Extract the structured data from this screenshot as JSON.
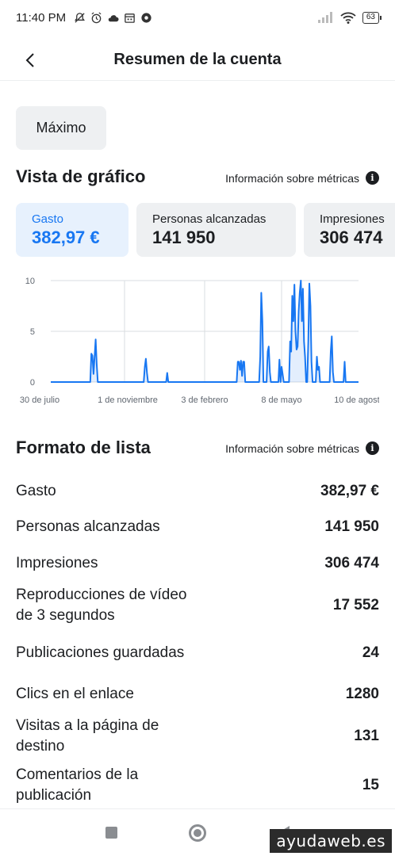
{
  "status_bar": {
    "time": "11:40 PM",
    "battery": "63",
    "icons_left": [
      "mute-icon",
      "alarm-icon",
      "cloud-icon",
      "calendar-icon",
      "settings-icon"
    ],
    "icons_right": [
      "signal-icon",
      "wifi-icon",
      "battery-icon"
    ]
  },
  "header": {
    "title": "Resumen de la cuenta",
    "back_icon": "chevron-left-icon"
  },
  "filter": {
    "label": "Máximo"
  },
  "chart_section": {
    "title": "Vista de gráfico",
    "info_link": "Información sobre métricas",
    "info_icon": "info-icon"
  },
  "metric_cards": [
    {
      "label": "Gasto",
      "value": "382,97 €",
      "active": true
    },
    {
      "label": "Personas alcanzadas",
      "value": "141 950",
      "active": false
    },
    {
      "label": "Impresiones",
      "value": "306 474",
      "active": false
    }
  ],
  "chart_data": {
    "type": "area",
    "title": "",
    "xlabel": "",
    "ylabel": "",
    "ylim": [
      0,
      10
    ],
    "yticks": [
      "10",
      "5",
      "0"
    ],
    "xticks": [
      "30 de julio",
      "1 de noviembre",
      "3 de febrero",
      "8 de mayo",
      "10 de agosto"
    ],
    "grid": true,
    "color": "#1877f2",
    "series": [
      {
        "values": [
          0,
          0,
          0,
          0,
          0,
          0,
          0,
          0,
          0,
          0,
          0,
          0,
          0,
          0,
          0,
          0,
          0,
          0,
          0,
          0,
          0,
          0,
          0,
          0,
          0,
          0,
          0,
          0,
          0,
          0,
          0,
          0,
          0,
          0,
          0,
          0,
          0,
          0,
          2.8,
          2.6,
          0.8,
          2.4,
          4.2,
          1.8,
          0,
          0,
          0,
          0,
          0,
          0,
          0,
          0,
          0,
          0,
          0,
          0,
          0,
          0,
          0,
          0,
          0,
          0,
          0,
          0,
          0,
          0,
          0,
          0,
          0,
          0,
          0,
          0,
          0,
          0,
          0,
          0,
          0,
          0,
          0,
          0,
          0,
          0,
          0,
          0,
          0,
          0,
          0,
          0,
          1.5,
          2.3,
          0.9,
          0,
          0,
          0,
          0,
          0,
          0,
          0,
          0,
          0,
          0,
          0,
          0,
          0,
          0,
          0,
          0,
          0,
          0,
          0.9,
          0,
          0,
          0,
          0,
          0,
          0,
          0,
          0,
          0,
          0,
          0,
          0,
          0,
          0,
          0,
          0,
          0,
          0,
          0,
          0,
          0,
          0,
          0,
          0,
          0,
          0,
          0,
          0,
          0,
          0,
          0,
          0,
          0,
          0,
          0,
          0,
          0,
          0,
          0,
          0,
          0,
          0,
          0,
          0,
          0,
          0,
          0,
          0,
          0,
          0,
          0,
          0,
          0,
          0,
          0,
          0,
          0,
          0,
          0,
          0,
          0,
          0,
          0,
          0,
          0,
          2,
          2,
          1.2,
          2.1,
          0.6,
          2,
          2,
          0,
          0,
          0,
          0,
          0,
          0,
          0,
          0,
          0,
          0,
          0,
          0,
          0,
          0,
          2.5,
          8.8,
          6,
          0,
          0,
          0,
          0,
          3,
          3.5,
          1,
          0,
          0,
          0,
          0,
          0,
          0,
          0,
          0,
          2.2,
          0,
          1.5,
          0.8,
          0,
          0,
          0,
          0,
          0,
          0,
          4,
          3,
          8.5,
          6,
          9.6,
          5,
          3.2,
          3.5,
          7,
          8.8,
          10,
          6,
          9.2,
          4,
          2.5,
          0,
          0,
          4,
          9.7,
          7.5,
          2,
          0,
          0,
          0,
          0,
          2.5,
          1.2,
          1.5,
          0,
          0,
          0,
          0,
          0,
          0,
          0,
          0,
          0,
          0,
          3,
          4.5,
          1,
          0,
          0,
          0,
          0,
          0,
          0,
          0,
          0,
          0,
          0,
          2,
          0,
          0,
          0,
          0,
          0,
          0,
          0,
          0,
          0,
          0,
          0,
          0,
          0
        ]
      }
    ]
  },
  "list_section": {
    "title": "Formato de lista",
    "info_link": "Información sobre métricas",
    "rows": [
      {
        "label": "Gasto",
        "value": "382,97 €"
      },
      {
        "label": "Personas alcanzadas",
        "value": "141 950"
      },
      {
        "label": "Impresiones",
        "value": "306 474"
      },
      {
        "label": "Reproducciones de vídeo de 3 segundos",
        "value": "17 552"
      },
      {
        "label": "Publicaciones guardadas",
        "value": "24"
      },
      {
        "label": "Clics en el enlace",
        "value": "1280"
      },
      {
        "label": "Visitas a la página de destino",
        "value": "131"
      },
      {
        "label": "Comentarios de la publicación",
        "value": "15"
      }
    ]
  },
  "nav_bar": {
    "icons": [
      "recents-icon",
      "home-icon",
      "back-icon"
    ]
  },
  "watermark": "ayudaweb.es"
}
